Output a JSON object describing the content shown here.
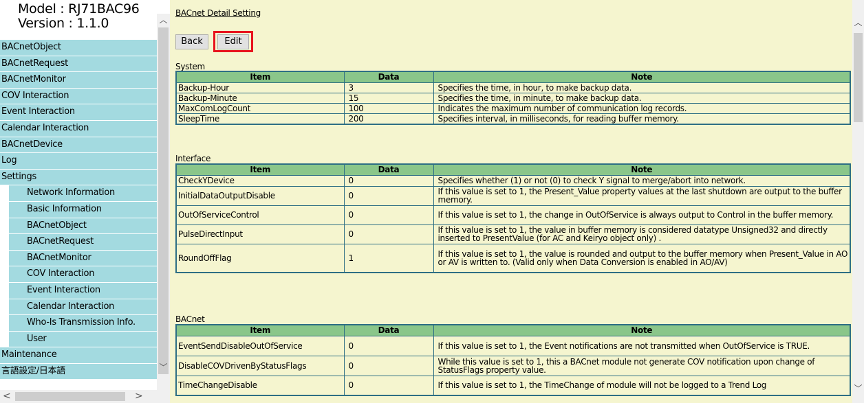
{
  "left": {
    "model": "Model : RJ71BAC96",
    "version": "Version : 1.1.0",
    "menu": [
      {
        "label": "BACnetObject",
        "sub": false
      },
      {
        "label": "BACnetRequest",
        "sub": false
      },
      {
        "label": "BACnetMonitor",
        "sub": false
      },
      {
        "label": "COV Interaction",
        "sub": false
      },
      {
        "label": "Event Interaction",
        "sub": false
      },
      {
        "label": "Calendar Interaction",
        "sub": false
      },
      {
        "label": "BACnetDevice",
        "sub": false
      },
      {
        "label": "Log",
        "sub": false
      },
      {
        "label": "Settings",
        "sub": false
      },
      {
        "label": "Network Information",
        "sub": true
      },
      {
        "label": "Basic Information",
        "sub": true
      },
      {
        "label": "BACnetObject",
        "sub": true
      },
      {
        "label": "BACnetRequest",
        "sub": true
      },
      {
        "label": "BACnetMonitor",
        "sub": true
      },
      {
        "label": "COV Interaction",
        "sub": true
      },
      {
        "label": "Event Interaction",
        "sub": true
      },
      {
        "label": "Calendar Interaction",
        "sub": true
      },
      {
        "label": "Who-Is Transmission Info.",
        "sub": true
      },
      {
        "label": "User",
        "sub": true
      },
      {
        "label": "Maintenance",
        "sub": false
      },
      {
        "label": "言語設定/日本語",
        "sub": false
      }
    ]
  },
  "main": {
    "title": "BACnet Detail Setting",
    "back_label": "Back",
    "edit_label": "Edit",
    "headers": {
      "item": "Item",
      "data": "Data",
      "note": "Note"
    },
    "sections": [
      {
        "label": "System",
        "rows": [
          {
            "item": "Backup-Hour",
            "data": "3",
            "note": "Specifies the time, in hour, to make backup data."
          },
          {
            "item": "Backup-Minute",
            "data": "15",
            "note": "Specifies the time, in minute, to make backup data."
          },
          {
            "item": "MaxComLogCount",
            "data": "100",
            "note": "Indicates the maximum number of communication log records."
          },
          {
            "item": "SleepTime",
            "data": "200",
            "note": "Specifies interval, in milliseconds, for reading buffer memory."
          }
        ]
      },
      {
        "label": "Interface",
        "rows": [
          {
            "item": "CheckYDevice",
            "data": "0",
            "note": "Specifies whether (1) or not (0) to check Y signal to merge/abort into network."
          },
          {
            "item": "InitialDataOutputDisable",
            "data": "0",
            "note": "If this value is set to 1, the Present_Value property values at the last shutdown are output to the buffer memory."
          },
          {
            "item": "OutOfServiceControl",
            "data": "0",
            "note": "If this value is set to 1, the change in OutOfService is always output to Control in the buffer memory."
          },
          {
            "item": "PulseDirectInput",
            "data": "0",
            "note": "If this value is set to 1, the value in buffer memory is considered datatype Unsigned32 and directly inserted to PresentValue (for AC and Keiryo object only) ."
          },
          {
            "item": "RoundOffFlag",
            "data": "1",
            "note": "If this value is set to 1, the value is rounded and output to the buffer memory when Present_Value in AO or AV is written to. (Valid only when Data Conversion is enabled in AO/AV)"
          }
        ]
      },
      {
        "label": "BACnet",
        "rows": [
          {
            "item": "EventSendDisableOutOfService",
            "data": "0",
            "note": "If this value is set to 1, the Event notifications are not transmitted when OutOfService is TRUE."
          },
          {
            "item": "DisableCOVDrivenByStatusFlags",
            "data": "0",
            "note": "While this value is set to 1, this a BACnet module not generate COV notification upon change of StatusFlags property value."
          },
          {
            "item": "TimeChangeDisable",
            "data": "0",
            "note": "If this value is set to 1, the TimeChange of module will not be logged to a Trend Log"
          }
        ]
      }
    ]
  }
}
